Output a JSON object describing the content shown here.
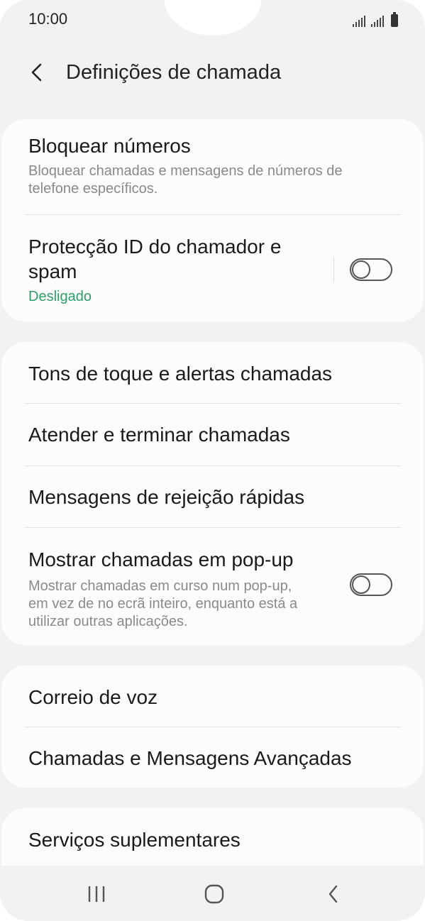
{
  "status_bar": {
    "time": "10:00"
  },
  "header": {
    "title": "Definições de chamada",
    "back_icon": "chevron-left-icon"
  },
  "group1": {
    "block_numbers": {
      "title": "Bloquear números",
      "subtitle_line1": "Bloquear chamadas e mensagens de números de",
      "subtitle_line2": "telefone específicos."
    },
    "caller_id": {
      "title_line1": "Protecção ID do chamador e",
      "title_line2": "spam",
      "status": "Desligado",
      "toggle_on": false
    }
  },
  "group2": {
    "ringtones": {
      "title": "Tons de toque e alertas chamadas"
    },
    "answer_end": {
      "title": "Atender e terminar chamadas"
    },
    "quick_decline": {
      "title": "Mensagens de rejeição rápidas"
    },
    "popup": {
      "title": "Mostrar chamadas em pop-up",
      "subtitle_line1": "Mostrar chamadas em curso num pop-up,",
      "subtitle_line2": "em vez de no ecrã inteiro, enquanto está a",
      "subtitle_line3": "utilizar outras aplicações.",
      "toggle_on": false
    }
  },
  "group3": {
    "voicemail": {
      "title": "Correio de voz"
    },
    "advanced": {
      "title": "Chamadas e Mensagens Avançadas"
    }
  },
  "group4": {
    "supplementary": {
      "title": "Serviços suplementares"
    }
  },
  "nav_bar": {
    "recents_icon": "recent-apps-icon",
    "home_icon": "home-icon",
    "back_icon": "back-icon"
  },
  "colors": {
    "background": "#f2f2f2",
    "card": "#fcfcfc",
    "status_green": "#2e9d66",
    "subtitle_gray": "#8a8a8a"
  }
}
